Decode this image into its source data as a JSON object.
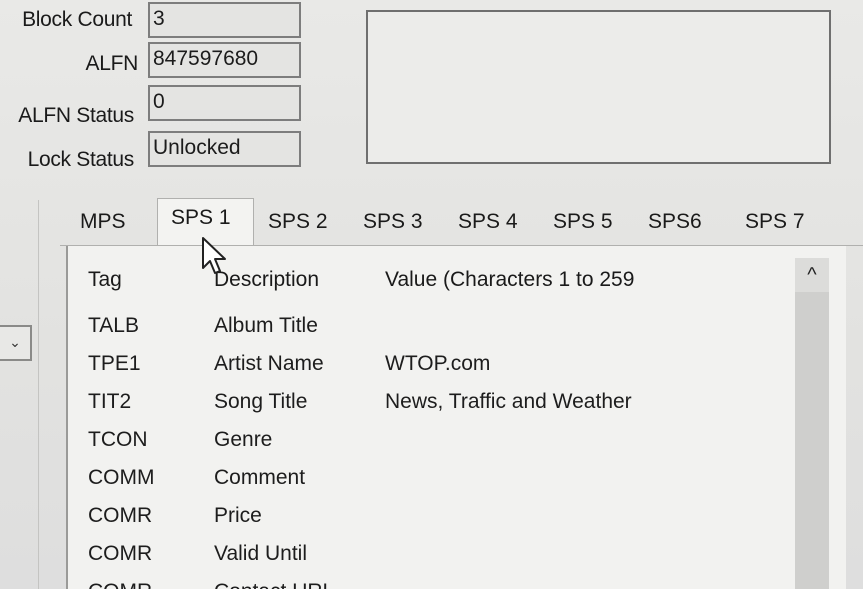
{
  "fields": {
    "block_count": {
      "label": "Block Count",
      "value": "3"
    },
    "alfn": {
      "label": "ALFN",
      "value": "847597680"
    },
    "alfn_status": {
      "label": "ALFN Status",
      "value": "0"
    },
    "lock_status": {
      "label": "Lock Status",
      "value": "Unlocked"
    }
  },
  "tabs": [
    "MPS",
    "SPS 1",
    "SPS 2",
    "SPS 3",
    "SPS 4",
    "SPS 5",
    "SPS6",
    "SPS 7"
  ],
  "active_tab": "SPS 1",
  "table": {
    "headers": [
      "Tag",
      "Description",
      "Value (Characters 1 to 259"
    ],
    "rows": [
      {
        "tag": "TALB",
        "description": "Album Title",
        "value": ""
      },
      {
        "tag": "TPE1",
        "description": "Artist Name",
        "value": "WTOP.com"
      },
      {
        "tag": "TIT2",
        "description": "Song Title",
        "value": "News, Traffic and Weather"
      },
      {
        "tag": "TCON",
        "description": "Genre",
        "value": ""
      },
      {
        "tag": "COMM",
        "description": "Comment",
        "value": ""
      },
      {
        "tag": "COMR",
        "description": "Price",
        "value": ""
      },
      {
        "tag": "COMR",
        "description": "Valid Until",
        "value": ""
      },
      {
        "tag": "COMR",
        "description": "Contact URL",
        "value": ""
      }
    ]
  },
  "icons": {
    "scroll_up": "chevron-up-icon",
    "dropdown": "chevron-down-icon",
    "cursor": "mouse-pointer-icon"
  }
}
